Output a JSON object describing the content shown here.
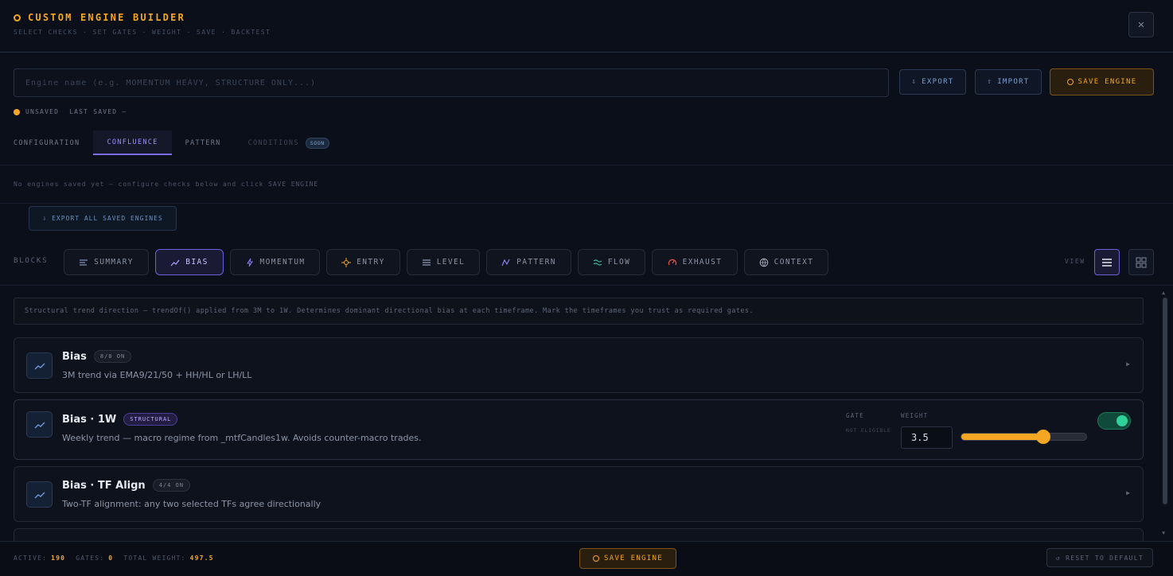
{
  "header": {
    "title": "CUSTOM ENGINE BUILDER",
    "subtitle": "SELECT CHECKS · SET GATES · WEIGHT · SAVE · BACKTEST",
    "close": "✕"
  },
  "engine": {
    "name_placeholder": "Engine name (e.g. MOMENTUM HEAVY, STRUCTURE ONLY...)",
    "name_value": "",
    "export_label": "EXPORT",
    "import_label": "IMPORT",
    "save_label": "SAVE ENGINE",
    "status": "UNSAVED",
    "last_saved": "LAST SAVED —"
  },
  "tabs": [
    {
      "label": "CONFIGURATION"
    },
    {
      "label": "CONFLUENCE"
    },
    {
      "label": "PATTERN"
    },
    {
      "label": "CONDITIONS",
      "badge": "SOON"
    }
  ],
  "no_engines_text": "No engines saved yet — configure checks below and click SAVE ENGINE",
  "export_all_label": "EXPORT ALL SAVED ENGINES",
  "blocks": {
    "label": "BLOCKS",
    "items": [
      "SUMMARY",
      "BIAS",
      "MOMENTUM",
      "ENTRY",
      "LEVEL",
      "PATTERN",
      "FLOW",
      "EXHAUST",
      "CONTEXT"
    ],
    "active": "BIAS"
  },
  "view_label": "VIEW",
  "description": "Structural trend direction — trendOf() applied from 3M to 1W. Determines dominant directional bias at each timeframe. Mark the timeframes you trust as required gates.",
  "cards": [
    {
      "title": "Bias",
      "badge": "8/8 ON",
      "subtitle": "3M trend via EMA9/21/50 + HH/HL or LH/LL"
    },
    {
      "title": "Bias · 1W",
      "badge": "STRUCTURAL",
      "subtitle": "Weekly trend — macro regime from _mtfCandles1w. Avoids counter-macro trades.",
      "gate_label": "GATE",
      "gate_value": "NOT ELIGIBLE",
      "weight_label": "WEIGHT",
      "weight": "3.5",
      "weight_fraction": 0.65,
      "enabled": true
    },
    {
      "title": "Bias · TF Align",
      "badge": "4/4 ON",
      "subtitle": "Two-TF alignment: any two selected TFs agree directionally"
    }
  ],
  "footer": {
    "active_label": "ACTIVE:",
    "active_value": "190",
    "gates_label": "GATES:",
    "gates_value": "0",
    "weight_label": "TOTAL WEIGHT:",
    "weight_value": "497.5",
    "save_label": "SAVE ENGINE",
    "reset_label": "RESET TO DEFAULT"
  },
  "colors": {
    "accent": "#f5a623",
    "active_violet": "#7c6cf2",
    "toggle_on": "#2ed39a"
  }
}
